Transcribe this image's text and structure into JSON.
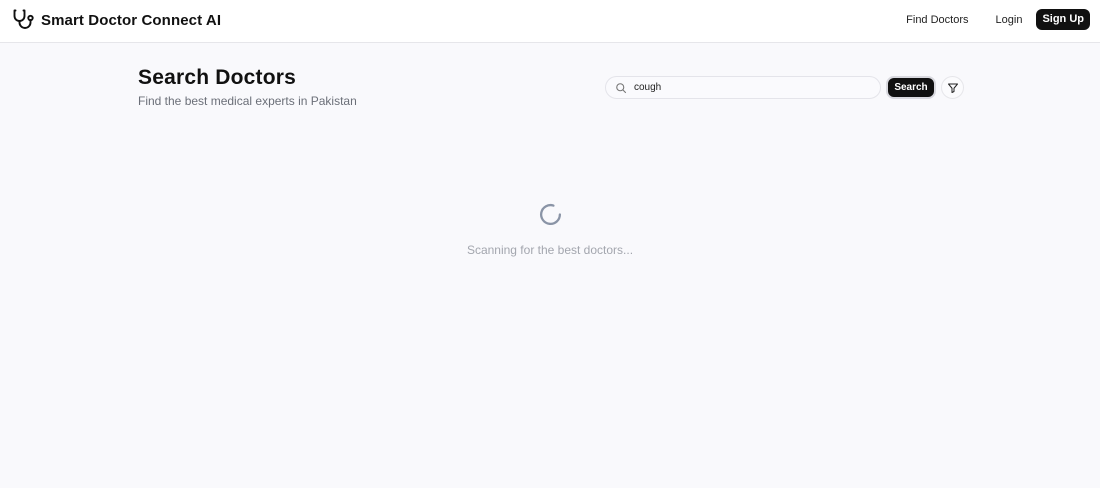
{
  "brand": {
    "name": "Smart Doctor Connect AI",
    "icon": "stethoscope-icon"
  },
  "nav": {
    "find_doctors": "Find Doctors",
    "login": "Login",
    "signup": "Sign Up"
  },
  "header": {
    "title": "Search Doctors",
    "subtitle": "Find the best medical experts in Pakistan"
  },
  "search": {
    "value": "cough",
    "button_label": "Search",
    "search_icon": "search-icon",
    "filter_icon": "filter-icon"
  },
  "loading": {
    "text": "Scanning for the best doctors...",
    "icon": "spinner-icon"
  },
  "colors": {
    "background": "#f9f9fc",
    "primary": "#111111",
    "muted_text": "#6b6f78",
    "spinner": "#8a94a6"
  }
}
